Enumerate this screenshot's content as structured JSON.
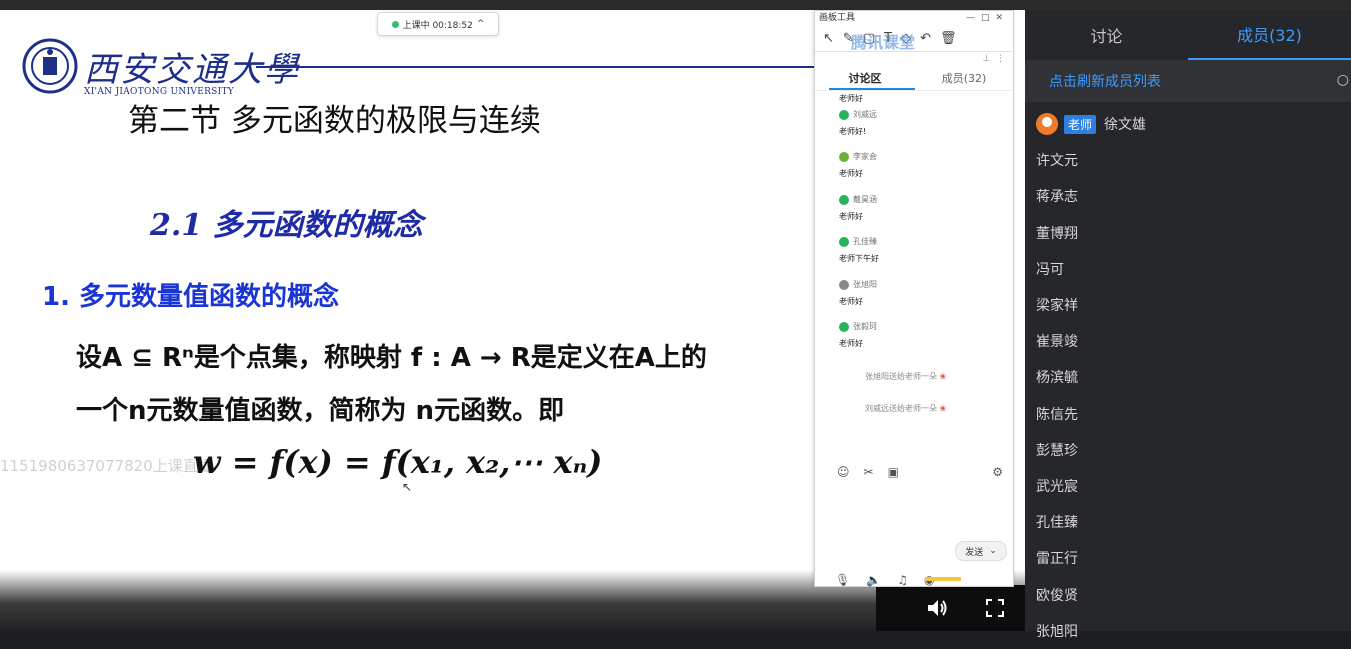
{
  "status": {
    "text": "上课中 00:18:52",
    "chevron": "^"
  },
  "slide": {
    "university_cn": "西安交通大學",
    "university_en": "XI'AN JIAOTONG UNIVERSITY",
    "section_title": "第二节  多元函数的极限与连续",
    "subsection_title": "2.1 多元函数的概念",
    "heading": "1.  多元数量值函数的概念",
    "para_line1": "设A ⊆ Rⁿ是个点集，称映射 f : A → R是定义在A上的",
    "para_line2": "一个n元数量值函数，简称为 n元函数。即",
    "formula": "w = f(x) = f(x₁, x₂,⋯ xₙ)",
    "watermark": "1151980637077820上课直播"
  },
  "whiteboard": {
    "title": "画板工具",
    "logo_text": "腾讯课堂",
    "tab_discussion": "讨论区",
    "tab_members": "成员(32)",
    "messages": [
      {
        "name": "老师好",
        "text": ""
      },
      {
        "name": "刘威远",
        "text": "老师好!"
      },
      {
        "name": "李家会",
        "text": "老师好"
      },
      {
        "name": "戴昊涵",
        "text": "老师好"
      },
      {
        "name": "孔佳臻",
        "text": "老师下午好"
      },
      {
        "name": "张旭阳",
        "text": "老师好"
      },
      {
        "name": "张毅珂",
        "text": "老师好"
      }
    ],
    "gifts": [
      "张旭阳送给老师一朵",
      "刘威远送给老师一朵"
    ],
    "send_label": "发送"
  },
  "panel": {
    "tab_discussion": "讨论",
    "tab_members": "成员(32)",
    "refresh_label": "点击刷新成员列表",
    "teacher_badge": "老师",
    "teacher_name": "徐文雄",
    "members": [
      "许文元",
      "蒋承志",
      "董博翔",
      "冯可",
      "梁家祥",
      "崔景竣",
      "杨滨毓",
      "陈信先",
      "彭慧珍",
      "武光宸",
      "孔佳臻",
      "雷正行",
      "欧俊贤",
      "张旭阳"
    ]
  },
  "colors": {
    "accent": "#3d9bff",
    "panel_bg": "#26272b",
    "slide_blue": "#1a34d6",
    "univ_blue": "#1e2f8a"
  }
}
